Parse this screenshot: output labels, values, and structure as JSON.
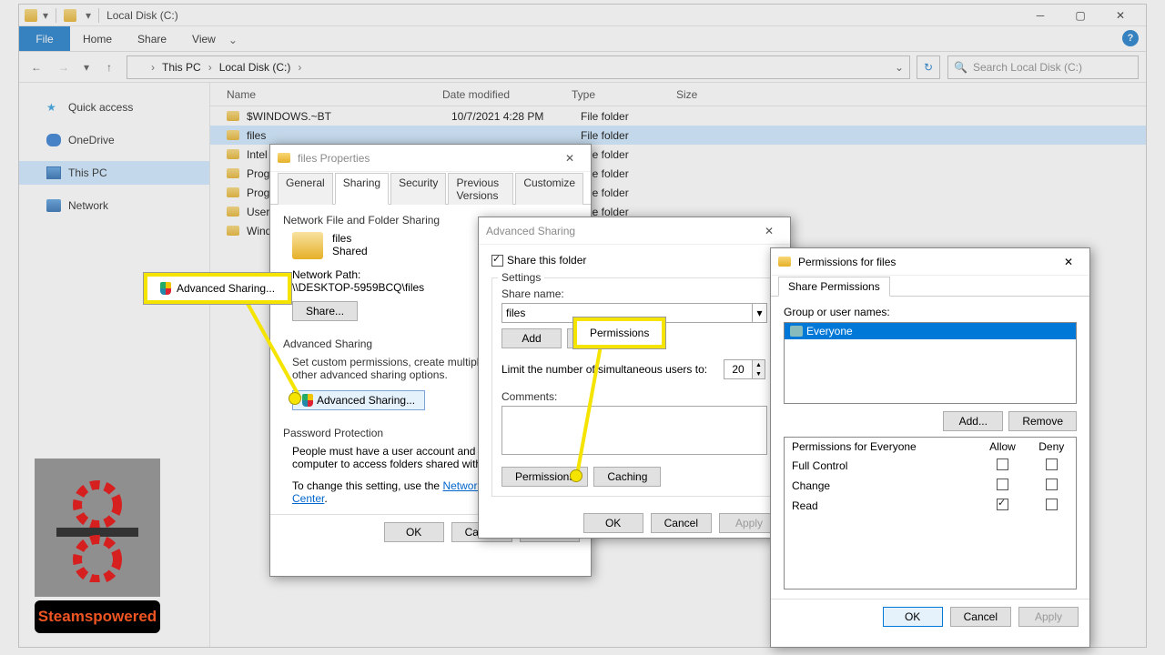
{
  "explorer": {
    "title": "Local Disk (C:)",
    "ribbon": {
      "file": "File",
      "home": "Home",
      "share": "Share",
      "view": "View"
    },
    "breadcrumb": {
      "pc": "This PC",
      "drive": "Local Disk (C:)"
    },
    "search_placeholder": "Search Local Disk (C:)",
    "nav": {
      "quick": "Quick access",
      "onedrive": "OneDrive",
      "thispc": "This PC",
      "network": "Network"
    },
    "cols": {
      "name": "Name",
      "date": "Date modified",
      "type": "Type",
      "size": "Size"
    },
    "rows": [
      {
        "name": "$WINDOWS.~BT",
        "date": "10/7/2021 4:28 PM",
        "type": "File folder"
      },
      {
        "name": "files",
        "date": "",
        "type": "File folder"
      },
      {
        "name": "Intel",
        "date": "",
        "type": "File folder"
      },
      {
        "name": "Program Files",
        "date": "",
        "type": "File folder"
      },
      {
        "name": "Program Files (x86)",
        "date": "",
        "type": "File folder"
      },
      {
        "name": "Users",
        "date": "",
        "type": "File folder"
      },
      {
        "name": "Windows",
        "date": "",
        "type": "File folder"
      }
    ]
  },
  "props": {
    "title": "files Properties",
    "tabs": {
      "general": "General",
      "sharing": "Sharing",
      "security": "Security",
      "prev": "Previous Versions",
      "custom": "Customize"
    },
    "section1_title": "Network File and Folder Sharing",
    "folder_name": "files",
    "status": "Shared",
    "netpath_label": "Network Path:",
    "netpath": "\\\\DESKTOP-5959BCQ\\files",
    "share_btn": "Share...",
    "section2_title": "Advanced Sharing",
    "section2_desc": "Set custom permissions, create multiple shares, and set other advanced sharing options.",
    "adv_btn": "Advanced Sharing...",
    "section3_title": "Password Protection",
    "section3_desc": "People must have a user account and password for this computer to access folders shared with everyone.",
    "section3_link_pre": "To change this setting, use the ",
    "section3_link": "Network and Sharing Center",
    "ok": "OK",
    "cancel": "Cancel",
    "apply": "Apply"
  },
  "adv": {
    "title": "Advanced Sharing",
    "share_chk": "Share this folder",
    "settings": "Settings",
    "share_name_label": "Share name:",
    "share_name": "files",
    "add": "Add",
    "remove": "Remove",
    "limit_label": "Limit the number of simultaneous users to:",
    "limit": "20",
    "comments_label": "Comments:",
    "perm_btn": "Permissions",
    "cache_btn": "Caching",
    "ok": "OK",
    "cancel": "Cancel",
    "apply": "Apply"
  },
  "perm": {
    "title": "Permissions for files",
    "tab": "Share Permissions",
    "group_label": "Group or user names:",
    "entry": "Everyone",
    "add": "Add...",
    "remove": "Remove",
    "perm_for": "Permissions for Everyone",
    "allow": "Allow",
    "deny": "Deny",
    "rows": [
      {
        "name": "Full Control",
        "allow": false,
        "deny": false
      },
      {
        "name": "Change",
        "allow": false,
        "deny": false
      },
      {
        "name": "Read",
        "allow": true,
        "deny": false
      }
    ],
    "ok": "OK",
    "cancel": "Cancel",
    "apply": "Apply"
  },
  "callouts": {
    "adv": "Advanced Sharing...",
    "perm": "Permissions"
  },
  "brand": "Steamspowered"
}
